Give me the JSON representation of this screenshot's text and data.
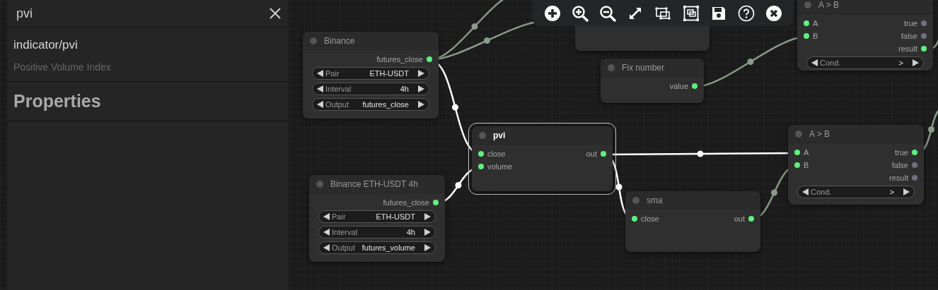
{
  "panel": {
    "title": "pvi",
    "node_type": "indicator/pvi",
    "description": "Positive Volume Index",
    "section": "Properties"
  },
  "toolbar": {
    "buttons": [
      {
        "kind": "add"
      },
      {
        "kind": "zoom-in"
      },
      {
        "kind": "zoom-out"
      },
      {
        "kind": "fit"
      },
      {
        "kind": "select"
      },
      {
        "kind": "group"
      },
      {
        "kind": "save"
      },
      {
        "kind": "help"
      },
      {
        "kind": "close"
      }
    ]
  },
  "nodes": [
    {
      "kind": "blank"
    },
    {
      "kind": "node",
      "title": "Binance",
      "selected": false,
      "outputs": [
        {
          "label": "futures_close",
          "connected": true
        }
      ],
      "widgets": [
        {
          "label": "Pair",
          "value": "ETH-USDT"
        },
        {
          "label": "Interval",
          "value": "4h"
        },
        {
          "label": "Output",
          "value": "futures_close"
        }
      ]
    },
    {
      "kind": "node",
      "title": "Fix number",
      "selected": false,
      "outputs": [
        {
          "label": "value",
          "connected": true
        }
      ]
    },
    {
      "kind": "node",
      "title": "A > B",
      "selected": false,
      "inputs": [
        {
          "label": "A",
          "connected": true
        },
        {
          "label": "B",
          "connected": true
        }
      ],
      "outputs": [
        {
          "label": "true",
          "connected": false
        },
        {
          "label": "false",
          "connected": false
        },
        {
          "label": "result",
          "connected": true
        }
      ],
      "widgets": [
        {
          "label": "Cond.",
          "value": ">"
        }
      ]
    },
    {
      "kind": "node",
      "title": "pvi",
      "selected": true,
      "inputs": [
        {
          "label": "close",
          "connected": true
        },
        {
          "label": "volume",
          "connected": true
        }
      ],
      "outputs": [
        {
          "label": "out",
          "connected": true
        }
      ]
    },
    {
      "kind": "node",
      "title": "Binance ETH-USDT 4h",
      "selected": false,
      "outputs": [
        {
          "label": "futures_close",
          "connected": true
        }
      ],
      "widgets": [
        {
          "label": "Pair",
          "value": "ETH-USDT"
        },
        {
          "label": "Interval",
          "value": "4h"
        },
        {
          "label": "Output",
          "value": "futures_volume"
        }
      ]
    },
    {
      "kind": "node",
      "title": "sma",
      "selected": false,
      "inputs": [
        {
          "label": "close",
          "connected": true
        }
      ],
      "outputs": [
        {
          "label": "out",
          "connected": true
        }
      ]
    },
    {
      "kind": "node",
      "title": "A > B",
      "selected": false,
      "inputs": [
        {
          "label": "A",
          "connected": true
        },
        {
          "label": "B",
          "connected": true
        }
      ],
      "outputs": [
        {
          "label": "true",
          "connected": true
        },
        {
          "label": "false",
          "connected": false
        },
        {
          "label": "result",
          "connected": false
        }
      ],
      "widgets": [
        {
          "label": "Cond.",
          "value": ">"
        }
      ]
    }
  ]
}
